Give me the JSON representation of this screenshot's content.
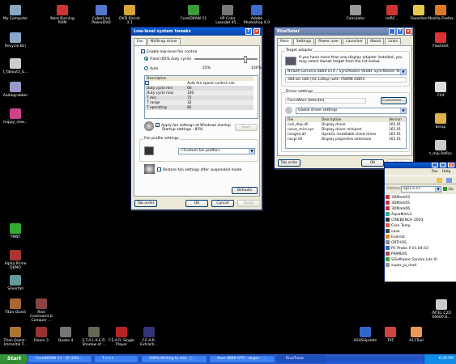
{
  "desktop_icons": [
    {
      "label": "My Computer",
      "color": "#8aa7c7"
    },
    {
      "label": "Nero Burning ROM",
      "color": "#c33"
    },
    {
      "label": "CyberLink PowerDVD",
      "color": "#5577cc"
    },
    {
      "label": "DVD Shrink 3.1",
      "color": "#d9a23a"
    },
    {
      "label": "CorelDRAW 11",
      "color": "#3a9b3a"
    },
    {
      "label": "HP Color LaserJet 45...",
      "color": "#777"
    },
    {
      "label": "Adobe Photoshop 6.0",
      "color": "#3b6dc9"
    },
    {
      "label": "Calculator",
      "color": "#999"
    },
    {
      "label": "mIRC...",
      "color": "#cc3333"
    },
    {
      "label": "Favorites",
      "color": "#e6c94c"
    },
    {
      "label": "Mozilla Firefox",
      "color": "#e07a22"
    },
    {
      "label": "Recycle Bin",
      "color": "#88aacc"
    },
    {
      "label": "FlashGet",
      "color": "#d33"
    },
    {
      "label": "t_fallout3_b...",
      "color": "#ccc"
    },
    {
      "label": "Audiograbber",
      "color": "#99c"
    },
    {
      "label": "Chif",
      "color": "#ddd"
    },
    {
      "label": "happy_new...",
      "color": "#cc4488"
    },
    {
      "label": "kerap",
      "color": "#dcb24b"
    },
    {
      "label": "t_maj Reflco",
      "color": "#ccc"
    },
    {
      "label": "TMNT",
      "color": "#3a3"
    },
    {
      "label": "Alpha Prime DEMO",
      "color": "#a33"
    },
    {
      "label": "Silverfall",
      "color": "#699"
    },
    {
      "label": "Titan Quest",
      "color": "#a63"
    },
    {
      "label": "Rise Command & Conquer ...",
      "color": "#844"
    },
    {
      "label": "Titan Quest - Immortal T...",
      "color": "#a73"
    },
    {
      "label": "Doom 3",
      "color": "#933"
    },
    {
      "label": "Quake 4",
      "color": "#777"
    },
    {
      "label": "S.T.A.L.K.E.R. Shadow of ...",
      "color": "#665"
    },
    {
      "label": "F.E.A.R. Single Player",
      "color": "#b22"
    },
    {
      "label": "F.E.A.R. Extracti...",
      "color": "#337"
    },
    {
      "label": "ASUSUpdate",
      "color": "#36c"
    },
    {
      "label": "TAT",
      "color": "#c44"
    },
    {
      "label": "A11Tool",
      "color": "#e95"
    },
    {
      "label": "INTEL C2D E6600 B...",
      "color": "#ccc"
    }
  ],
  "lowlevel": {
    "title": "Low-level system tweaks",
    "tabs": [
      "Fan",
      "NVStrap driver"
    ],
    "enable_label": "Enable low-level fan control",
    "fixed_label": "Fixed (85% duty cycle)",
    "auto_label": "Auto",
    "slider_min": "25%",
    "slider_max": "100%",
    "table_header": "Description",
    "rows": [
      {
        "desc": "Auto fan speed control rule",
        "val": ""
      },
      {
        "desc": "Duty cycle min",
        "val": "60"
      },
      {
        "desc": "Duty cycle max",
        "val": "100"
      },
      {
        "desc": "T min",
        "val": "72"
      },
      {
        "desc": "T range",
        "val": "32"
      },
      {
        "desc": "T operating",
        "val": "82"
      }
    ],
    "apply_label": "Apply fan settings at Windows startup",
    "startup_label": "Startup settings : 85%",
    "save_label": "Save",
    "profile_group": "Fan profile settings",
    "profile_value": "<Custom fan profile>",
    "restore_label": "Restore fan settings after suspended mode",
    "defaults_label": "Defaults",
    "tab_order": "Tab order",
    "ok": "OK",
    "cancel": "Cancel",
    "apply": "Apply"
  },
  "rivatuner": {
    "title": "RivaTuner",
    "tabs": [
      "Main",
      "Settings",
      "Power user",
      "Launcher",
      "About",
      "Links"
    ],
    "target_group": "Target adapter",
    "target_text": "If you have more than one display adapter installed, you may select itweak target from the list below.",
    "adapter": "NVIDIA GeForce 8800 GTX / SyncMaster 940BF SyncMaster M...",
    "adapter_info": "384-bit G80 (A2,128sp) with 768MB DDR3",
    "driver_group": "Driver settings",
    "forceware": "ForceWare detected",
    "customize": "Customize...",
    "global": "Global driver settings",
    "cols": [
      "File",
      "Description",
      "Version"
    ],
    "files": [
      {
        "file": "nv4_disp.dll",
        "desc": "Display driver",
        "ver": "165.01"
      },
      {
        "file": "nvsvc_mini.sys",
        "desc": "Display driver miniport",
        "ver": "165.01"
      },
      {
        "file": "nvoglnt.dll",
        "desc": "OpenGL installable client driver",
        "ver": "165.01"
      },
      {
        "file": "nvcpl.dll",
        "desc": "Display properties extension",
        "ver": "165.01"
      }
    ],
    "tab_order": "Tab order",
    "ok": "OK",
    "cancel": "Cancel",
    "apply": "Apply"
  },
  "explorer": {
    "title": "T e s t",
    "menu": [
      "Fav",
      "Help"
    ],
    "address_label": "Address",
    "address": "op\\T e s t",
    "go": "Go",
    "items": [
      {
        "name": "3DMark03",
        "color": "#c33"
      },
      {
        "name": "3DMark05",
        "color": "#c33"
      },
      {
        "name": "3DMark06",
        "color": "#c33"
      },
      {
        "name": "AquaMark3",
        "color": "#3a8"
      },
      {
        "name": "CINEBENCH 2003",
        "color": "#333"
      },
      {
        "name": "Core Temp",
        "color": "#e53"
      },
      {
        "name": "cpuz",
        "color": "#444"
      },
      {
        "name": "Everest",
        "color": "#e80"
      },
      {
        "name": "ORTHOS",
        "color": "#888"
      },
      {
        "name": "PC Probe II V1.04.03",
        "color": "#36c"
      },
      {
        "name": "PRIME95",
        "color": "#a44"
      },
      {
        "name": "SiSoftware Sandra Lite XI",
        "color": "#3a3"
      },
      {
        "name": "super_pi_mod",
        "color": "#999"
      }
    ]
  },
  "taskbar": {
    "start": "Start",
    "tasks": [
      {
        "label": "CorelDRAW 11 - [E:\\200...",
        "active": false
      },
      {
        "label": "T e s t",
        "active": false
      },
      {
        "label": "100% Writing to disc - [...",
        "active": false
      },
      {
        "label": "Asus 8800 GTS - skupa - ...",
        "active": false
      },
      {
        "label": "RivaTuner",
        "active": true
      }
    ],
    "clock": "6:39 PM"
  }
}
